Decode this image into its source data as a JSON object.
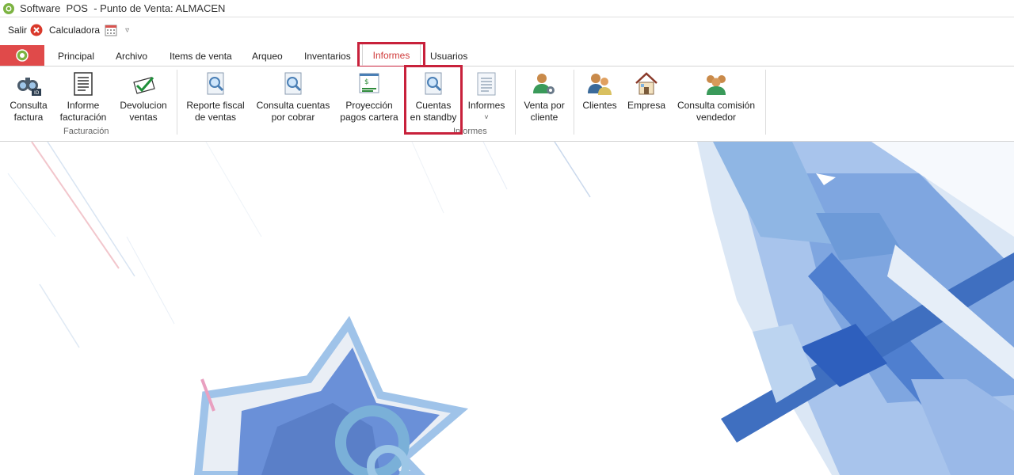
{
  "window": {
    "title": "Software  POS  - Punto de Venta: ALMACEN"
  },
  "quick_access": {
    "exit_label": "Salir",
    "calculator_label": "Calculadora"
  },
  "tabs": [
    {
      "label": "Principal"
    },
    {
      "label": "Archivo"
    },
    {
      "label": "Items de venta"
    },
    {
      "label": "Arqueo"
    },
    {
      "label": "Inventarios"
    },
    {
      "label": "Informes"
    },
    {
      "label": "Usuarios"
    }
  ],
  "ribbon": {
    "groups": {
      "facturacion": "Facturación",
      "informes": "Informes"
    },
    "buttons": {
      "consulta_factura": [
        "Consulta",
        "factura"
      ],
      "informe_facturacion": [
        "Informe",
        "facturación"
      ],
      "devolucion_ventas": [
        "Devolucion",
        "ventas"
      ],
      "reporte_fiscal": [
        "Reporte fiscal",
        "de ventas"
      ],
      "consulta_cuentas": [
        "Consulta cuentas",
        "por cobrar"
      ],
      "proyeccion_pagos": [
        "Proyección",
        "pagos cartera"
      ],
      "cuentas_standby": [
        "Cuentas",
        "en standby"
      ],
      "informes_dropdown": [
        "Informes",
        "˅"
      ],
      "venta_cliente": [
        "Venta por",
        "cliente"
      ],
      "clientes": [
        "Clientes"
      ],
      "empresa": [
        "Empresa"
      ],
      "consulta_comision": [
        "Consulta comisión",
        "vendedor"
      ]
    }
  },
  "colors": {
    "accent_red": "#c8213b",
    "file_tab": "#e04a4a",
    "active_tab_text": "#d03a3a"
  }
}
